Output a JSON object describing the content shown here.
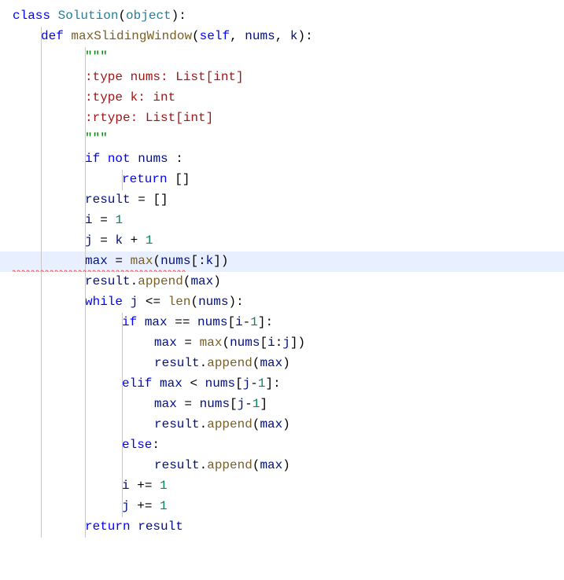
{
  "code": {
    "lines": [
      {
        "id": 1,
        "indent": 0,
        "content": "class Solution(object):",
        "highlight": false
      },
      {
        "id": 2,
        "indent": 1,
        "content": "def maxSlidingWindow(self, nums, k):",
        "highlight": false
      },
      {
        "id": 3,
        "indent": 2,
        "content": "\"\"\"",
        "highlight": false
      },
      {
        "id": 4,
        "indent": 2,
        "content": ":type nums: List[int]",
        "highlight": false
      },
      {
        "id": 5,
        "indent": 2,
        "content": ":type k: int",
        "highlight": false
      },
      {
        "id": 6,
        "indent": 2,
        "content": ":rtype: List[int]",
        "highlight": false
      },
      {
        "id": 7,
        "indent": 2,
        "content": "\"\"\"",
        "highlight": false
      },
      {
        "id": 8,
        "indent": 2,
        "content": "if not nums :",
        "highlight": false
      },
      {
        "id": 9,
        "indent": 3,
        "content": "return []",
        "highlight": false
      },
      {
        "id": 10,
        "indent": 2,
        "content": "result = []",
        "highlight": false
      },
      {
        "id": 11,
        "indent": 2,
        "content": "i = 1",
        "highlight": false
      },
      {
        "id": 12,
        "indent": 2,
        "content": "j = k + 1",
        "highlight": false
      },
      {
        "id": 13,
        "indent": 2,
        "content": "max = max(nums[:k])",
        "highlight": true,
        "squiggly": true
      },
      {
        "id": 14,
        "indent": 2,
        "content": "result.append(max)",
        "highlight": false
      },
      {
        "id": 15,
        "indent": 2,
        "content": "while j <= len(nums):",
        "highlight": false
      },
      {
        "id": 16,
        "indent": 3,
        "content": "if max == nums[i-1]:",
        "highlight": false
      },
      {
        "id": 17,
        "indent": 4,
        "content": "max = max(nums[i:j])",
        "highlight": false
      },
      {
        "id": 18,
        "indent": 4,
        "content": "result.append(max)",
        "highlight": false
      },
      {
        "id": 19,
        "indent": 3,
        "content": "elif max < nums[j-1]:",
        "highlight": false
      },
      {
        "id": 20,
        "indent": 4,
        "content": "max = nums[j-1]",
        "highlight": false
      },
      {
        "id": 21,
        "indent": 4,
        "content": "result.append(max)",
        "highlight": false
      },
      {
        "id": 22,
        "indent": 3,
        "content": "else:",
        "highlight": false
      },
      {
        "id": 23,
        "indent": 4,
        "content": "result.append(max)",
        "highlight": false
      },
      {
        "id": 24,
        "indent": 3,
        "content": "i += 1",
        "highlight": false
      },
      {
        "id": 25,
        "indent": 3,
        "content": "j += 1",
        "highlight": false
      },
      {
        "id": 26,
        "indent": 2,
        "content": "return result",
        "highlight": false
      }
    ]
  }
}
